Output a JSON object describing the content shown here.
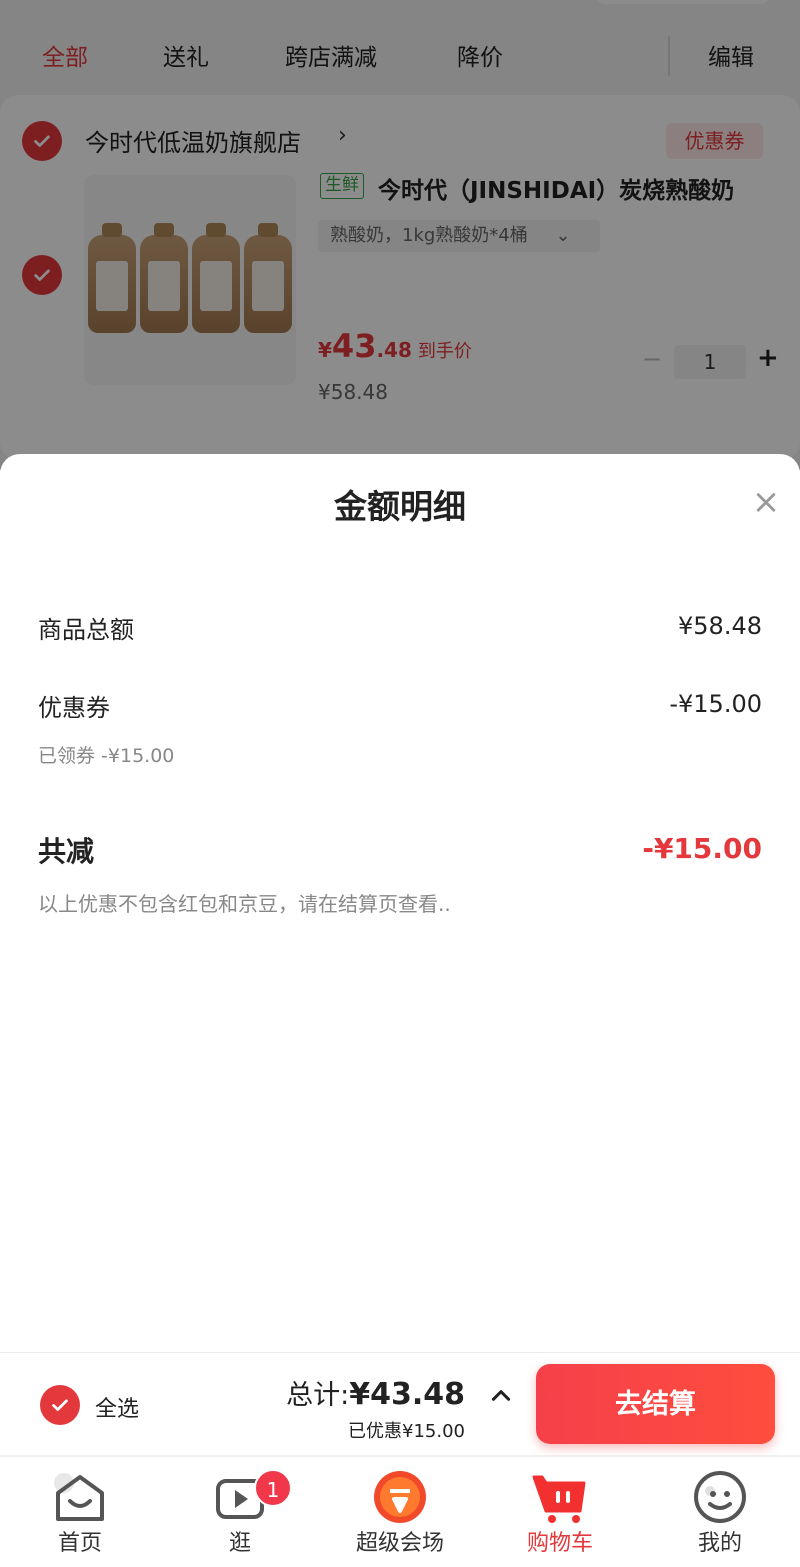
{
  "filter_tabs": {
    "all": "全部",
    "gift": "送礼",
    "cross_store": "跨店满减",
    "price_drop": "降价",
    "edit": "编辑"
  },
  "store": {
    "name": "今时代低温奶旗舰店",
    "chevron": "›",
    "coupon_label": "优惠券"
  },
  "product": {
    "fresh_tag": "生鲜",
    "title": "今时代（JINSHIDAI）炭烧熟酸奶",
    "spec": "熟酸奶，1kg熟酸奶*4桶",
    "spec_chevron": "⌄",
    "price_symbol": "¥",
    "price_int": "43",
    "price_dec": ".48",
    "price_note": "到手价",
    "original_price": "¥58.48",
    "qty_minus": "−",
    "quantity": "1",
    "qty_plus": "+"
  },
  "sheet": {
    "title": "金额明细",
    "close": "×",
    "goods_total_label": "商品总额",
    "goods_total_value": "¥58.48",
    "coupon_label": "优惠券",
    "coupon_value": "-¥15.00",
    "coupon_sub": "已领券 -¥15.00",
    "total_reduce_label": "共减",
    "total_reduce_value": "-¥15.00",
    "note": "以上优惠不包含红包和京豆，请在结算页查看.."
  },
  "checkout": {
    "select_all": "全选",
    "total_prefix": "总计:",
    "total_amount": "¥43.48",
    "saved": "已优惠¥15.00",
    "button": "去结算"
  },
  "tabbar": {
    "home": "首页",
    "browse": "逛",
    "browse_badge": "1",
    "venue": "超级会场",
    "cart": "购物车",
    "mine": "我的"
  },
  "colors": {
    "accent": "#e4393c",
    "fresh_green": "#35a54a"
  }
}
